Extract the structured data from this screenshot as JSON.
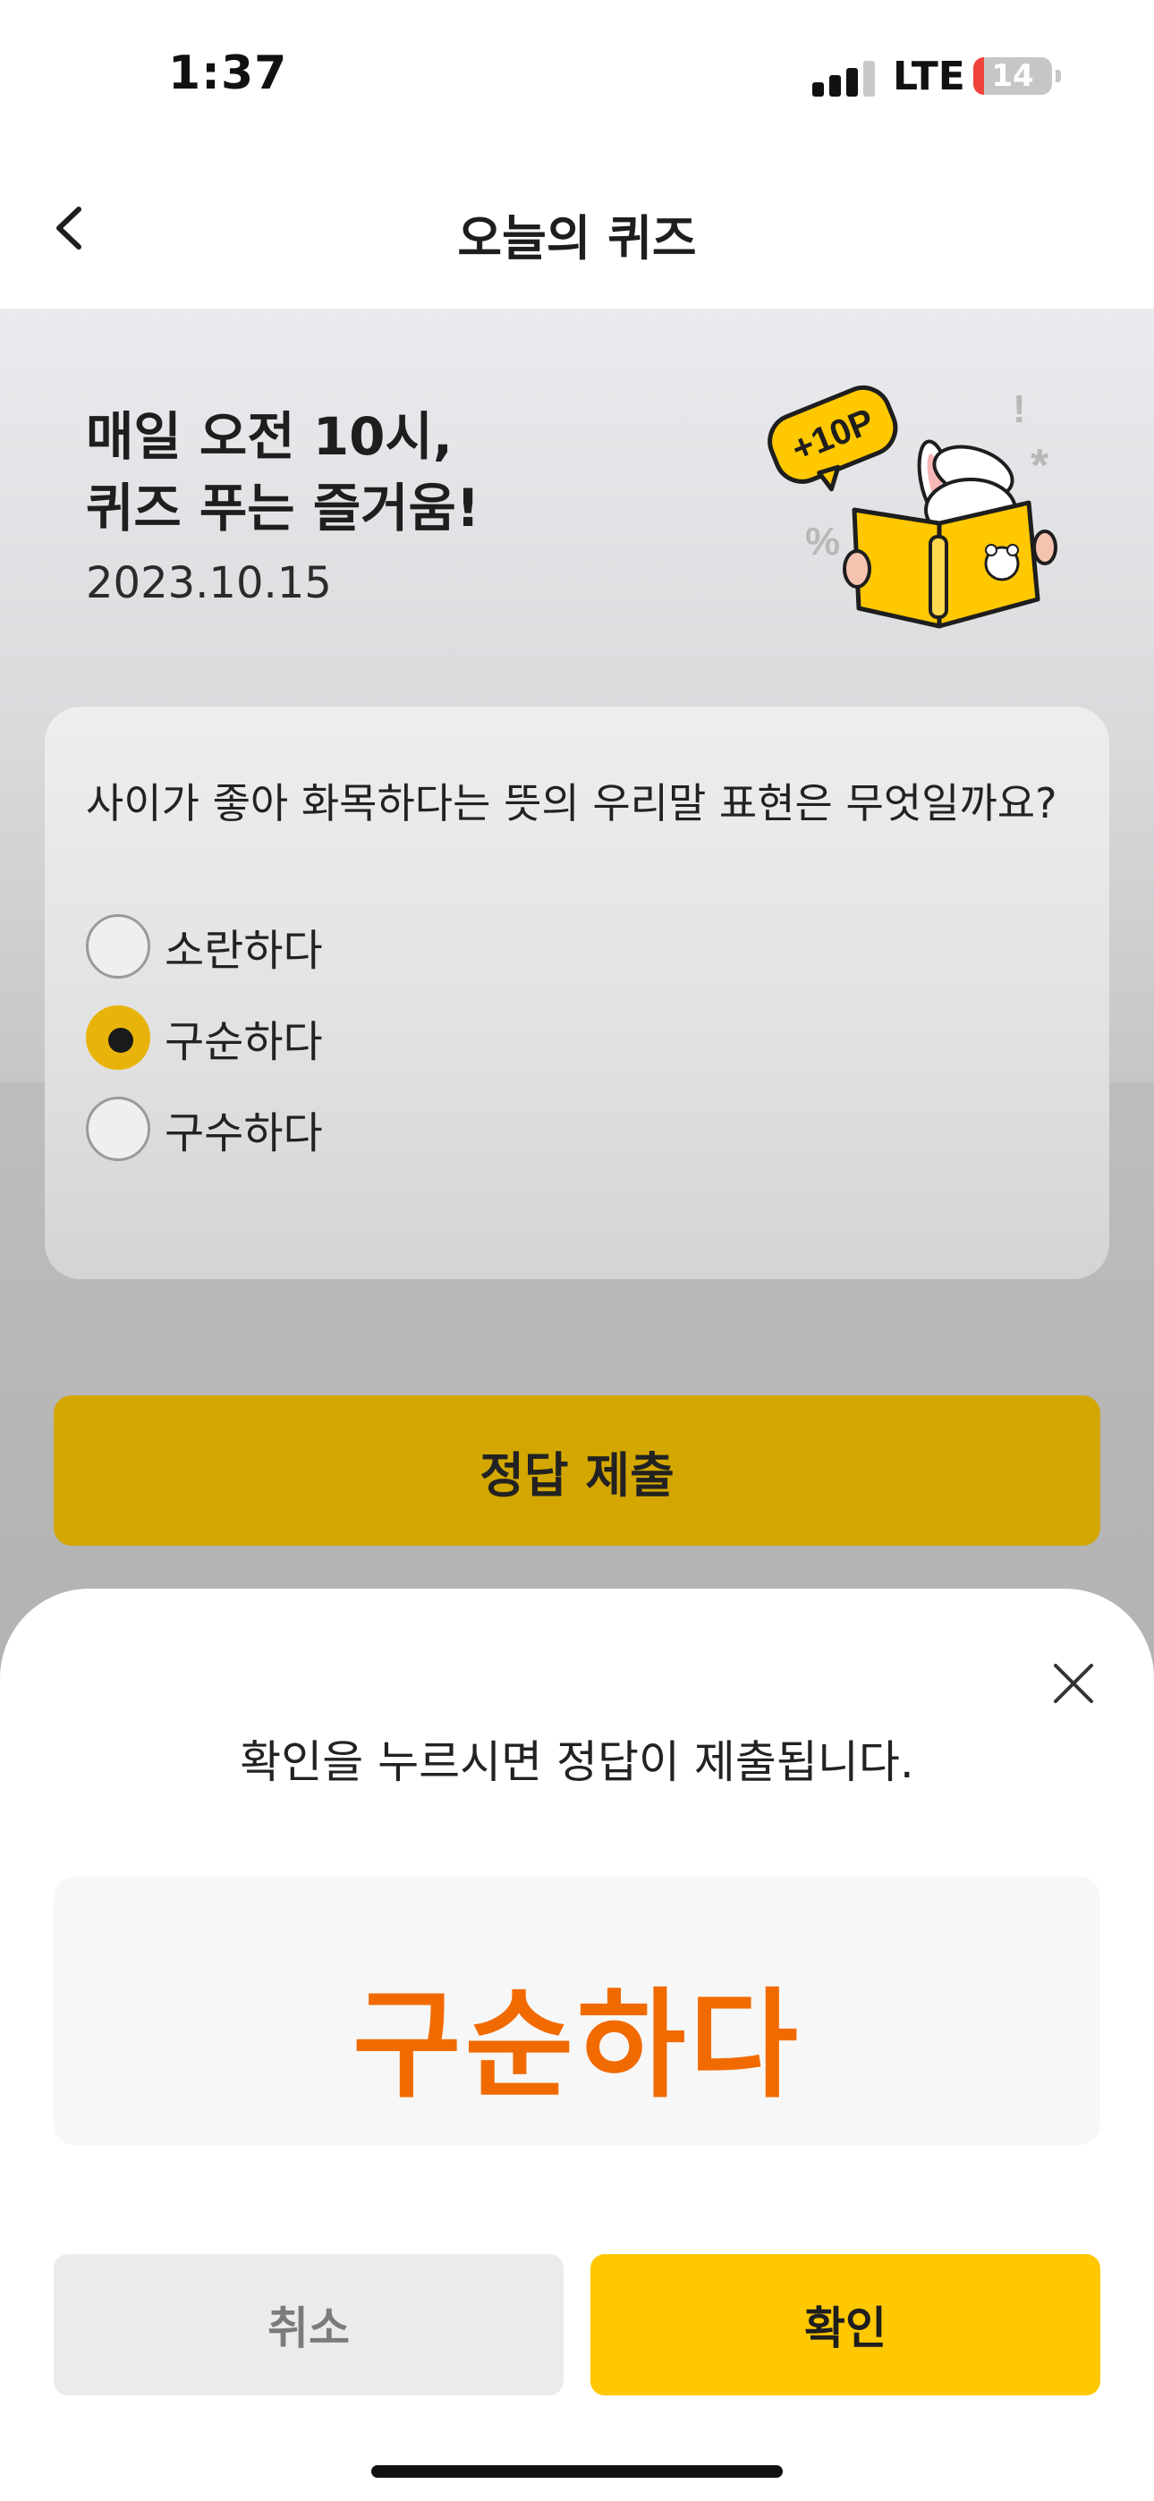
{
  "status_bar": {
    "time": "1:37",
    "network": "LTE",
    "battery_level": "14",
    "battery_fraction": 0.14,
    "signal_bars_active": 3,
    "signal_bars_total": 4
  },
  "nav": {
    "title": "오늘의 퀴즈",
    "back_icon": "chevron-left-icon"
  },
  "hero": {
    "title_line1": "매일 오전 10시,",
    "title_line2": "퀴즈 푸는 즐거움!",
    "date": "2023.10.15",
    "badge": "+10P"
  },
  "quiz": {
    "question": "사이가 좋아 화목하다는 뜻의 우리말 표현은 무엇일까요?",
    "options": [
      {
        "label": "소란하다",
        "selected": false
      },
      {
        "label": "구순하다",
        "selected": true
      },
      {
        "label": "구수하다",
        "selected": false
      }
    ],
    "submit_label": "정답 제출"
  },
  "sheet": {
    "close_icon": "close-icon",
    "message": "확인을 누르시면 정답이 제출됩니다.",
    "selected_answer": "구순하다",
    "cancel_label": "취소",
    "confirm_label": "확인"
  },
  "colors": {
    "accent_yellow": "#ffc800",
    "answer_orange": "#f16a00",
    "radio_selected": "#e8b40b",
    "battery_low": "#f0423a"
  }
}
